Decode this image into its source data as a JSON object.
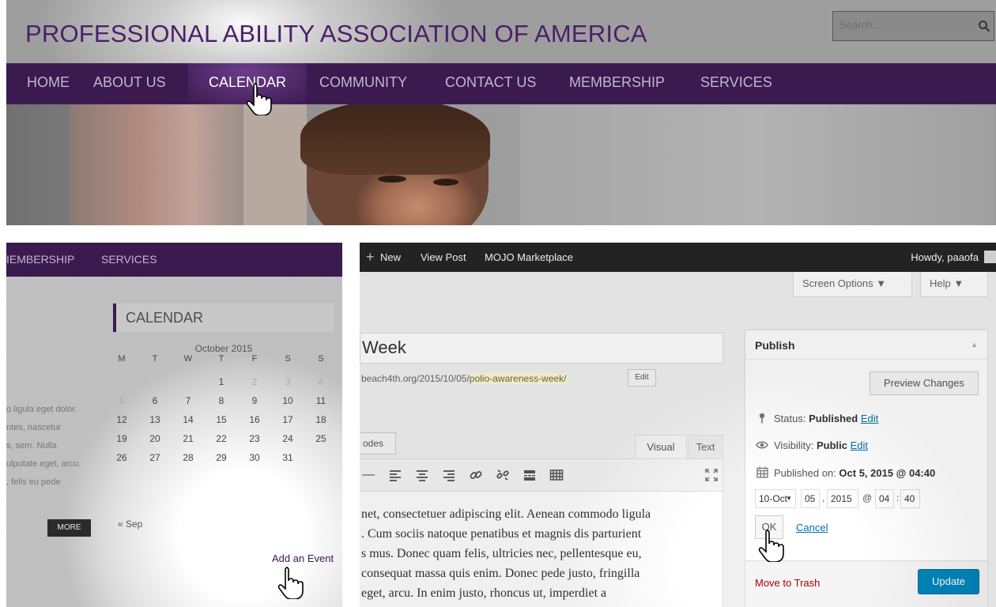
{
  "site": {
    "title": "PROFESSIONAL ABILITY ASSOCIATION OF AMERICA",
    "search_placeholder": "Search...",
    "nav": [
      "HOME",
      "ABOUT US",
      "CALENDAR",
      "COMMUNITY",
      "CONTACT US",
      "MEMBERSHIP",
      "SERVICES"
    ],
    "active_nav": "CALENDAR"
  },
  "sidebar_page": {
    "nav": [
      "MEMBERSHIP",
      "SERVICES"
    ],
    "nav_visible_text": [
      "IEMBERSHIP",
      "SERVICES"
    ],
    "lorem_lines": [
      "o ligula eget dolor.",
      "ntes, nascetur",
      "s, sem. Nulla",
      "ulputate eget, arcu.",
      ", felis eu pede"
    ],
    "more_label": "MORE",
    "calendar": {
      "widget_title": "CALENDAR",
      "month": "October 2015",
      "weekdays": [
        "M",
        "T",
        "W",
        "T",
        "F",
        "S",
        "S"
      ],
      "weeks": [
        [
          "",
          "",
          "",
          "1",
          "2",
          "3",
          "4"
        ],
        [
          "5",
          "6",
          "7",
          "8",
          "9",
          "10",
          "11"
        ],
        [
          "12",
          "13",
          "14",
          "15",
          "16",
          "17",
          "18"
        ],
        [
          "19",
          "20",
          "21",
          "22",
          "23",
          "24",
          "25"
        ],
        [
          "26",
          "27",
          "28",
          "29",
          "30",
          "31",
          ""
        ]
      ],
      "prev_link": "« Sep",
      "add_event": "Add an Event"
    }
  },
  "wp_admin": {
    "admin_bar": {
      "new_label": "New",
      "view_post": "View Post",
      "marketplace": "MOJO Marketplace",
      "howdy": "Howdy, paaofa"
    },
    "screen_options": "Screen Options ▼",
    "help": "Help ▼",
    "post_title": "Week",
    "permalink_prefix": "beach4th.org/2015/10/05/",
    "permalink_slug": "polio-awareness-week/",
    "permalink_edit": "Edit",
    "shortcodes_btn": "odes",
    "tab_visual": "Visual",
    "tab_text": "Text",
    "editor_lines": [
      "net, consectetuer adipiscing elit. Aenean commodo ligula",
      ". Cum sociis natoque penatibus et magnis dis parturient",
      "s mus. Donec quam felis, ultricies nec, pellentesque eu,",
      "consequat massa quis enim. Donec pede justo, fringilla",
      "eget, arcu. In enim justo, rhoncus ut, imperdiet a"
    ],
    "publish": {
      "title": "Publish",
      "toggle": "▲",
      "preview": "Preview Changes",
      "status_label": "Status:",
      "status_value": "Published",
      "visibility_label": "Visibility:",
      "visibility_value": "Public",
      "edit": "Edit",
      "published_on_label": "Published on:",
      "published_on_value": "Oct 5, 2015 @ 04:40",
      "date_month": "10-Oct",
      "date_day": "05",
      "date_year": "2015",
      "date_hour": "04",
      "date_minute": "40",
      "ok": "OK",
      "cancel": "Cancel",
      "trash": "Move to Trash",
      "update": "Update"
    }
  },
  "colors": {
    "nav_purple": "#3a1a4f",
    "title_purple": "#4b1e69",
    "wp_blue": "#0085ba",
    "trash_red": "#a00000"
  }
}
